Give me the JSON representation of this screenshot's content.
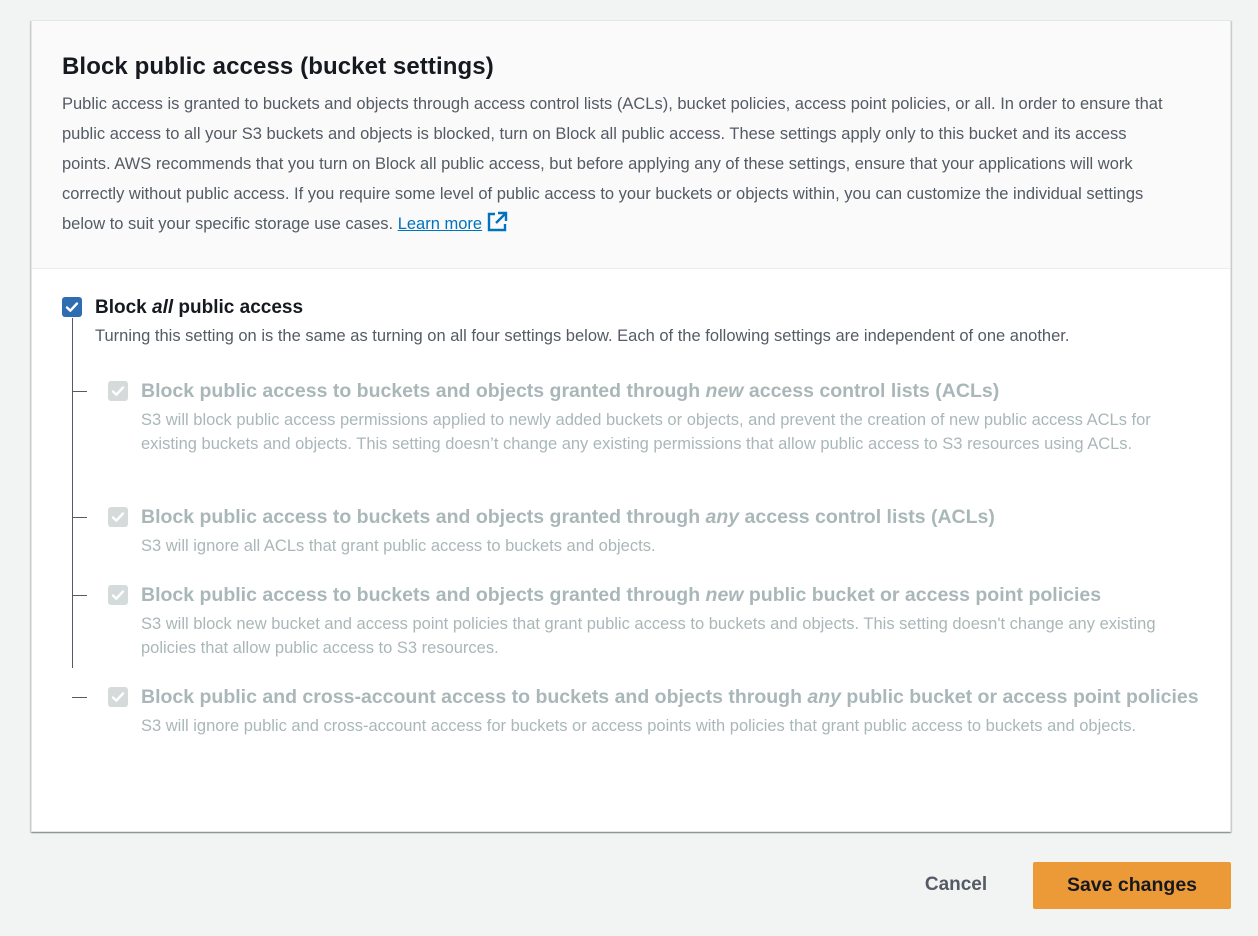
{
  "panel": {
    "title": "Block public access (bucket settings)",
    "description": "Public access is granted to buckets and objects through access control lists (ACLs), bucket policies, access point policies, or all. In order to ensure that public access to all your S3 buckets and objects is blocked, turn on Block all public access. These settings apply only to this bucket and its access points. AWS recommends that you turn on Block all public access, but before applying any of these settings, ensure that your applications will work correctly without public access. If you require some level of public access to your buckets or objects within, you can customize the individual settings below to suit your specific storage use cases.",
    "learn_more": "Learn more",
    "learn_more_icon": "external-link-icon"
  },
  "master": {
    "label_pre": "Block ",
    "label_em": "all",
    "label_post": " public access",
    "checked": true,
    "description": "Turning this setting on is the same as turning on all four settings below. Each of the following settings are independent of one another."
  },
  "settings": [
    {
      "title_pre": "Block public access to buckets and objects granted through ",
      "title_em": "new",
      "title_post": " access control lists (ACLs)",
      "description": "S3 will block public access permissions applied to newly added buckets or objects, and prevent the creation of new public access ACLs for existing buckets and objects. This setting doesn’t change any existing permissions that allow public access to S3 resources using ACLs.",
      "checked": true,
      "disabled": true
    },
    {
      "title_pre": "Block public access to buckets and objects granted through ",
      "title_em": "any",
      "title_post": " access control lists (ACLs)",
      "description": "S3 will ignore all ACLs that grant public access to buckets and objects.",
      "checked": true,
      "disabled": true
    },
    {
      "title_pre": "Block public access to buckets and objects granted through ",
      "title_em": "new",
      "title_post": " public bucket or access point policies",
      "description": "S3 will block new bucket and access point policies that grant public access to buckets and objects. This setting doesn't change any existing policies that allow public access to S3 resources.",
      "checked": true,
      "disabled": true
    },
    {
      "title_pre": "Block public and cross-account access to buckets and objects through ",
      "title_em": "any",
      "title_post": " public bucket or access point policies",
      "description": "S3 will ignore public and cross-account access for buckets or access points with policies that grant public access to buckets and objects.",
      "checked": true,
      "disabled": true
    }
  ],
  "footer": {
    "cancel_label": "Cancel",
    "save_label": "Save changes"
  },
  "colors": {
    "checkbox_checked": "#2f6db1",
    "checkbox_disabled": "#d5dbdb",
    "primary_button": "#ec9a37",
    "link": "#0073bb"
  }
}
